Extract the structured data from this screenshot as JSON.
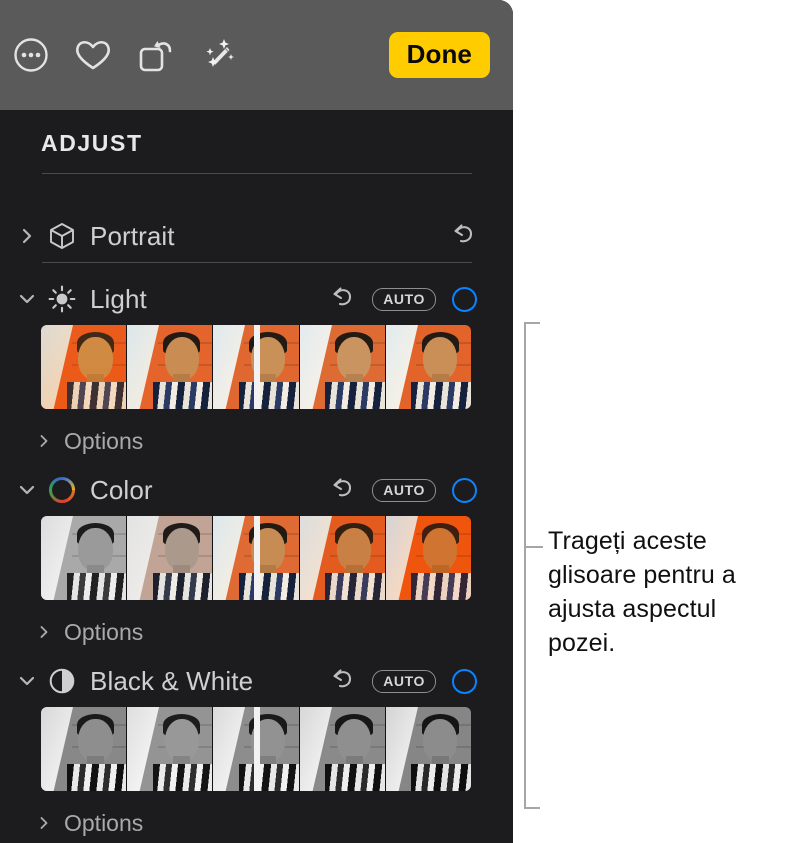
{
  "toolbar": {
    "buttons": [
      {
        "name": "more-options-button",
        "icon": "more-circle-icon"
      },
      {
        "name": "favorite-button",
        "icon": "heart-icon"
      },
      {
        "name": "rotate-button",
        "icon": "rotate-icon"
      },
      {
        "name": "auto-enhance-button",
        "icon": "magic-wand-icon"
      }
    ],
    "done_label": "Done",
    "done_color": "#FFCC00",
    "background": "#5a5a5a"
  },
  "panel": {
    "background": "#1c1c1e",
    "section_title": "ADJUST",
    "accent_color": "#0a84ff",
    "options_label": "Options",
    "auto_label": "AUTO"
  },
  "adjustments": [
    {
      "id": "portrait",
      "label": "Portrait",
      "icon": "cube-icon",
      "expanded": false,
      "chevron": "chevron-right",
      "has_reset": true,
      "has_auto": false,
      "has_toggle": false,
      "has_slider": false,
      "has_options": false
    },
    {
      "id": "light",
      "label": "Light",
      "icon": "sun-icon",
      "expanded": true,
      "chevron": "chevron-down",
      "has_reset": true,
      "has_auto": true,
      "has_toggle": true,
      "has_slider": true,
      "has_options": true,
      "slider_value_position": "50%",
      "slider_kind": "exposure"
    },
    {
      "id": "color",
      "label": "Color",
      "icon": "color-wheel-icon",
      "expanded": true,
      "chevron": "chevron-down",
      "has_reset": true,
      "has_auto": true,
      "has_toggle": true,
      "has_slider": true,
      "has_options": true,
      "slider_value_position": "50%",
      "slider_kind": "saturation"
    },
    {
      "id": "black-and-white",
      "label": "Black & White",
      "icon": "contrast-circle-icon",
      "expanded": true,
      "chevron": "chevron-down",
      "has_reset": true,
      "has_auto": true,
      "has_toggle": true,
      "has_slider": true,
      "has_options": true,
      "slider_value_position": "50%",
      "slider_kind": "monochrome"
    }
  ],
  "callout": {
    "text": "Trageți aceste glisoare pentru a ajusta aspectul pozei.",
    "bracket_color": "#a6a6a6"
  }
}
